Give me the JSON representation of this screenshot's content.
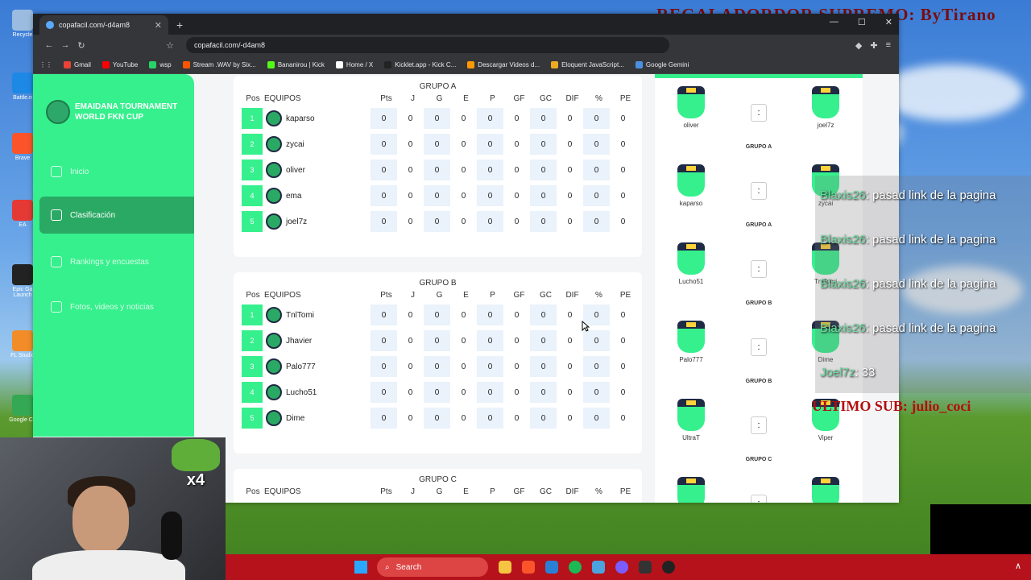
{
  "overlay": {
    "title": "REGALADORDOR SUPREMO: ByTirano",
    "last_sub": "ULTIMO SUB: julio_coci"
  },
  "desktop_icons": [
    "Recycle",
    "Battle.n",
    "Brave",
    "EA",
    "Epic Ga Launch",
    "FL Studio",
    "Google Ch"
  ],
  "browser": {
    "tab_title": "copafacil.com/-d4am8",
    "url": "copafacil.com/-d4am8",
    "bookmarks": [
      {
        "label": "Gmail",
        "color": "#ea4335"
      },
      {
        "label": "YouTube",
        "color": "#ff0000"
      },
      {
        "label": "wsp",
        "color": "#25d366"
      },
      {
        "label": "Stream .WAV by Six...",
        "color": "#ff5500"
      },
      {
        "label": "Bananirou | Kick",
        "color": "#53fc18"
      },
      {
        "label": "Home / X",
        "color": "#ffffff"
      },
      {
        "label": "Kicklet.app - Kick C...",
        "color": "#222222"
      },
      {
        "label": "Descargar Videos d...",
        "color": "#ff9900"
      },
      {
        "label": "Eloquent JavaScript...",
        "color": "#eeaa22"
      },
      {
        "label": "Google Gemini",
        "color": "#4a90e2"
      }
    ]
  },
  "sidebar": {
    "brand": "EMAIDANA TOURNAMENT WORLD FKN CUP",
    "items": [
      {
        "label": "Inicio"
      },
      {
        "label": "Clasificación"
      },
      {
        "label": "Rankings y encuestas"
      },
      {
        "label": "Fotos, videos y noticias"
      }
    ]
  },
  "standings": {
    "headers": {
      "pos": "Pos",
      "team": "EQUIPOS",
      "cols": [
        "Pts",
        "J",
        "G",
        "E",
        "P",
        "GF",
        "GC",
        "DIF",
        "%",
        "PE"
      ]
    },
    "groups": [
      {
        "title": "GRUPO A",
        "teams": [
          {
            "pos": "1",
            "name": "kaparso",
            "stats": [
              "0",
              "0",
              "0",
              "0",
              "0",
              "0",
              "0",
              "0",
              "0",
              "0"
            ]
          },
          {
            "pos": "2",
            "name": "zycai",
            "stats": [
              "0",
              "0",
              "0",
              "0",
              "0",
              "0",
              "0",
              "0",
              "0",
              "0"
            ]
          },
          {
            "pos": "3",
            "name": "oliver",
            "stats": [
              "0",
              "0",
              "0",
              "0",
              "0",
              "0",
              "0",
              "0",
              "0",
              "0"
            ]
          },
          {
            "pos": "4",
            "name": "ema",
            "stats": [
              "0",
              "0",
              "0",
              "0",
              "0",
              "0",
              "0",
              "0",
              "0",
              "0"
            ]
          },
          {
            "pos": "5",
            "name": "joel7z",
            "stats": [
              "0",
              "0",
              "0",
              "0",
              "0",
              "0",
              "0",
              "0",
              "0",
              "0"
            ]
          }
        ]
      },
      {
        "title": "GRUPO B",
        "teams": [
          {
            "pos": "1",
            "name": "TnlTomi",
            "stats": [
              "0",
              "0",
              "0",
              "0",
              "0",
              "0",
              "0",
              "0",
              "0",
              "0"
            ]
          },
          {
            "pos": "2",
            "name": "Jhavier",
            "stats": [
              "0",
              "0",
              "0",
              "0",
              "0",
              "0",
              "0",
              "0",
              "0",
              "0"
            ]
          },
          {
            "pos": "3",
            "name": "Palo777",
            "stats": [
              "0",
              "0",
              "0",
              "0",
              "0",
              "0",
              "0",
              "0",
              "0",
              "0"
            ]
          },
          {
            "pos": "4",
            "name": "Lucho51",
            "stats": [
              "0",
              "0",
              "0",
              "0",
              "0",
              "0",
              "0",
              "0",
              "0",
              "0"
            ]
          },
          {
            "pos": "5",
            "name": "Dime",
            "stats": [
              "0",
              "0",
              "0",
              "0",
              "0",
              "0",
              "0",
              "0",
              "0",
              "0"
            ]
          }
        ]
      },
      {
        "title": "GRUPO C",
        "teams": []
      }
    ]
  },
  "matches": [
    {
      "home": "oliver",
      "away": "joel7z",
      "score": ":",
      "group": "GRUPO A"
    },
    {
      "home": "kaparso",
      "away": "zycai",
      "score": ":",
      "group": "GRUPO A"
    },
    {
      "home": "Lucho51",
      "away": "TnlTomi",
      "score": ":",
      "group": "GRUPO B"
    },
    {
      "home": "Palo777",
      "away": "Dime",
      "score": ":",
      "group": "GRUPO B"
    },
    {
      "home": "UltraT",
      "away": "Viper",
      "score": ":",
      "group": "GRUPO C"
    },
    {
      "home": "",
      "away": "",
      "score": ":",
      "group": ""
    }
  ],
  "chat": [
    {
      "user": "Blaxis26",
      "text": ": pasad link de la pagina"
    },
    {
      "user": "Blaxis26",
      "text": ": pasad link de la pagina"
    },
    {
      "user": "Blaxis26",
      "text": ": pasad link de la pagina"
    },
    {
      "user": "Blaxis26",
      "text": ": pasad link de la pagina"
    },
    {
      "user": "Joel7z",
      "text": ": 33"
    }
  ],
  "emote_multiplier": "x4",
  "taskbar": {
    "search_placeholder": "Search"
  }
}
